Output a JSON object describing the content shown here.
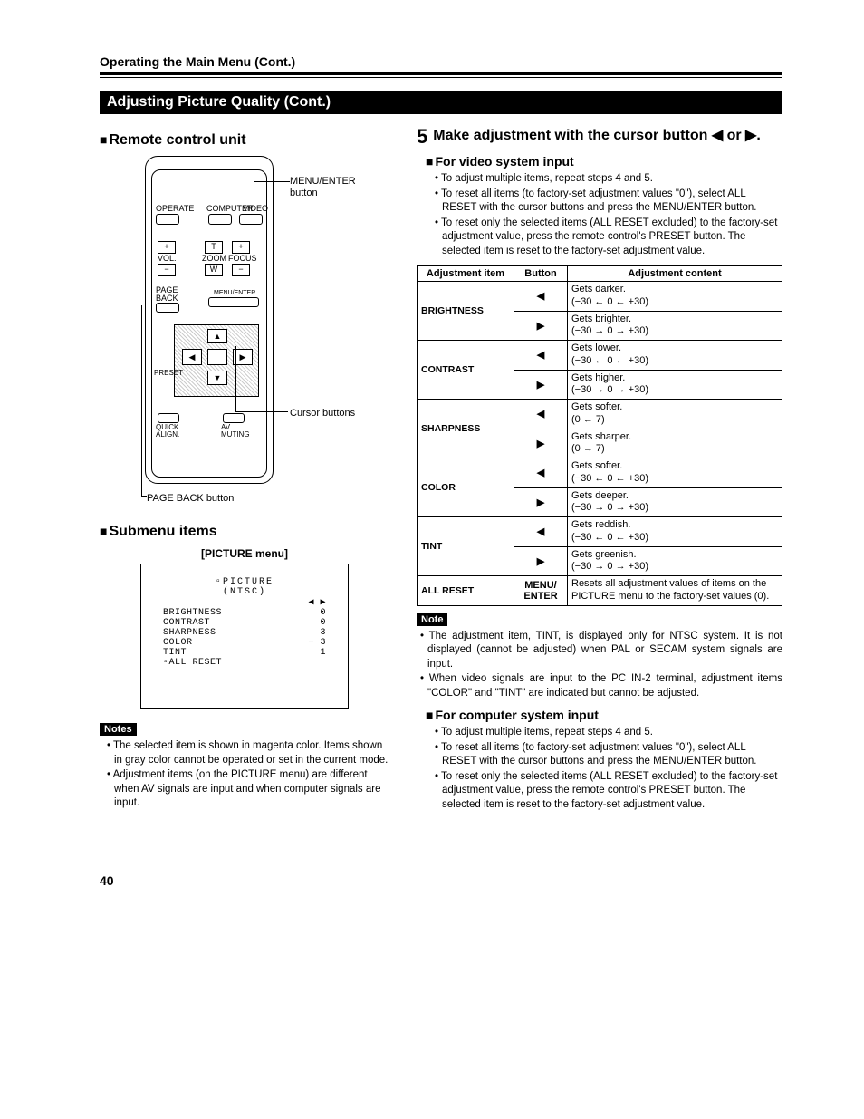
{
  "header": {
    "page_title": "Operating the Main Menu (Cont.)",
    "section_bar": "Adjusting Picture Quality (Cont.)"
  },
  "left": {
    "remote_heading": "Remote control unit",
    "remote_callouts": {
      "menu_enter": "MENU/ENTER button",
      "cursor": "Cursor buttons",
      "page_back": "PAGE BACK button"
    },
    "remote_labels": {
      "operate": "OPERATE",
      "computer": "COMPUTER",
      "video": "VIDEO",
      "vol": "VOL.",
      "zoom": "ZOOM",
      "focus": "FOCUS",
      "t": "T",
      "w": "W",
      "plus": "+",
      "minus": "−",
      "page_back": "PAGE BACK",
      "menu_enter": "MENU/ENTER",
      "preset": "PRESET",
      "quick_align": "QUICK ALIGN.",
      "av_muting": "AV MUTING"
    },
    "submenu_heading": "Submenu items",
    "picture_menu_label": "[PICTURE menu]",
    "picture_screen": {
      "title": "PICTURE",
      "subtitle": "(NTSC)",
      "arrows": "◀ ▶",
      "rows": [
        {
          "label": "BRIGHTNESS",
          "val": "0"
        },
        {
          "label": "CONTRAST",
          "val": "0"
        },
        {
          "label": "SHARPNESS",
          "val": "3"
        },
        {
          "label": "COLOR",
          "val": "−   3"
        },
        {
          "label": "TINT",
          "val": "1"
        }
      ],
      "all_reset": "ALL RESET"
    },
    "notes_badge": "Notes",
    "notes": [
      "The selected item is shown in magenta color. Items shown in gray color cannot be operated or set in the current mode.",
      "Adjustment items (on the PICTURE menu) are different when AV signals are input and when computer signals are input."
    ]
  },
  "right": {
    "step_num": "5",
    "step_text": "Make adjustment with the cursor button ◀ or ▶.",
    "for_video_heading": "For video system input",
    "video_bullets": [
      "To adjust multiple items, repeat steps 4 and 5.",
      "To reset all items (to factory-set adjustment values \"0\"), select ALL RESET with the cursor buttons and press the MENU/ENTER button.",
      "To reset only the selected items (ALL RESET excluded) to the factory-set adjustment value, press the remote control's PRESET button. The selected item is reset to the factory-set adjustment value."
    ],
    "table_headers": {
      "item": "Adjustment item",
      "button": "Button",
      "content": "Adjustment content"
    },
    "table": [
      {
        "item": "BRIGHTNESS",
        "rows": [
          {
            "btn": "◀",
            "txt": "Gets darker.\n(−30 ← 0 ← +30)"
          },
          {
            "btn": "▶",
            "txt": "Gets brighter.\n(−30 → 0 → +30)"
          }
        ]
      },
      {
        "item": "CONTRAST",
        "rows": [
          {
            "btn": "◀",
            "txt": "Gets lower.\n(−30 ← 0 ← +30)"
          },
          {
            "btn": "▶",
            "txt": "Gets higher.\n(−30 → 0 → +30)"
          }
        ]
      },
      {
        "item": "SHARPNESS",
        "rows": [
          {
            "btn": "◀",
            "txt": "Gets softer.\n(0 ← 7)"
          },
          {
            "btn": "▶",
            "txt": "Gets sharper.\n(0 → 7)"
          }
        ]
      },
      {
        "item": "COLOR",
        "rows": [
          {
            "btn": "◀",
            "txt": "Gets softer.\n(−30 ← 0 ← +30)"
          },
          {
            "btn": "▶",
            "txt": "Gets deeper.\n(−30 → 0 → +30)"
          }
        ]
      },
      {
        "item": "TINT",
        "rows": [
          {
            "btn": "◀",
            "txt": "Gets reddish.\n(−30 ← 0 ← +30)"
          },
          {
            "btn": "▶",
            "txt": "Gets greenish.\n(−30 → 0 → +30)"
          }
        ]
      },
      {
        "item": "ALL RESET",
        "rows": [
          {
            "btn": "MENU/\nENTER",
            "txt": "Resets all adjustment values of items on the PICTURE menu to the factory-set values (0)."
          }
        ]
      }
    ],
    "note_badge": "Note",
    "note_bullets": [
      "The adjustment item, TINT, is displayed only for NTSC system. It is not displayed (cannot be adjusted) when PAL or SECAM system signals are input.",
      "When video signals are input to the PC IN-2 terminal, adjustment items \"COLOR\" and \"TINT\" are indicated but cannot be adjusted."
    ],
    "for_computer_heading": "For computer system input",
    "computer_bullets": [
      "To adjust multiple items, repeat steps 4 and 5.",
      "To reset all items (to factory-set adjustment values \"0\"), select ALL RESET with the cursor buttons and press the MENU/ENTER button.",
      "To reset only the selected items (ALL RESET excluded) to the factory-set adjustment value, press the remote control's PRESET button. The selected item is reset to the factory-set adjustment value."
    ]
  },
  "page_number": "40"
}
